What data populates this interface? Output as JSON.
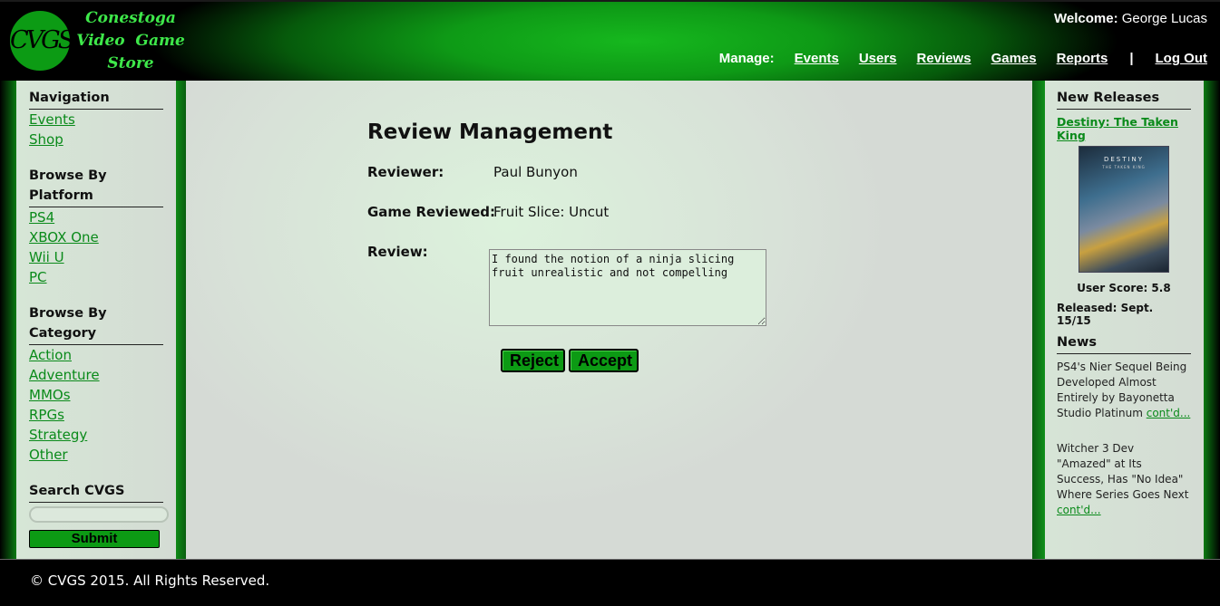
{
  "header": {
    "logo_mark": "CVGS",
    "logo_lines": [
      "Conestoga",
      "Video  Game",
      "Store"
    ],
    "welcome_label": "Welcome:",
    "welcome_user": "George Lucas",
    "manage_label": "Manage:",
    "nav": [
      "Events",
      "Users",
      "Reviews",
      "Games",
      "Reports"
    ],
    "separator": "|",
    "logout": "Log Out"
  },
  "sidebar": {
    "navigation_title": "Navigation",
    "navigation_items": [
      "Events",
      "Shop"
    ],
    "platform_title": "Browse By Platform",
    "platform_items": [
      "PS4",
      "XBOX One",
      "Wii U",
      "PC"
    ],
    "category_title": "Browse By Category",
    "category_items": [
      "Action",
      "Adventure",
      "MMOs",
      "RPGs",
      "Strategy",
      "Other"
    ],
    "search_title": "Search CVGS",
    "search_value": "",
    "submit_label": "Submit"
  },
  "main": {
    "title": "Review Management",
    "reviewer_label": "Reviewer:",
    "reviewer_value": "Paul Bunyon",
    "game_label": "Game Reviewed:",
    "game_value": "Fruit Slice: Uncut",
    "review_label": "Review:",
    "review_text": "I found the notion of a ninja slicing fruit unrealistic and not compelling",
    "reject_label": "Reject",
    "accept_label": "Accept"
  },
  "right": {
    "new_releases_title": "New Releases",
    "release_name": "Destiny: The Taken King",
    "cover_title": "DESTINY",
    "cover_subtitle": "THE TAKEN KING",
    "user_score": "User Score: 5.8",
    "released": "Released: Sept. 15/15",
    "news_title": "News",
    "news": [
      {
        "text": "PS4's Nier Sequel Being Developed Almost Entirely by Bayonetta Studio Platinum",
        "link": "cont'd..."
      },
      {
        "text": "Witcher 3 Dev \"Amazed\" at Its Success, Has \"No Idea\" Where Series Goes Next",
        "link": "cont'd..."
      }
    ]
  },
  "footer": {
    "copyright": "© CVGS 2015. All Rights Reserved."
  },
  "colors": {
    "brand_green": "#0c9a14",
    "link_green": "#0a8a1a",
    "panel_bg": "#d6e2d6"
  }
}
